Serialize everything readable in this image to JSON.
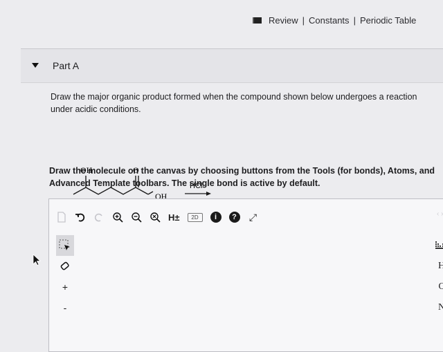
{
  "topbar": {
    "review_label": "Review",
    "sep1": "|",
    "constants_label": "Constants",
    "sep2": "|",
    "periodic_label": "Periodic Table"
  },
  "part": {
    "title": "Part A"
  },
  "question": {
    "text": "Draw the major organic product formed when the compound shown below undergoes a reaction under acidic conditions."
  },
  "molecule": {
    "oh_top": "OH",
    "o_top": "O",
    "oh_right": "OH",
    "reagent": "HCl"
  },
  "instructions": {
    "text": "Draw the molecule on the canvas by choosing buttons from the Tools (for bonds), Atoms, and Advanced Template toolbars. The single bond is active by default."
  },
  "toolbar": {
    "icons": [
      "new-document-icon",
      "undo-icon",
      "redo-icon",
      "zoom-in-icon",
      "zoom-out-icon",
      "zoom-reset-icon",
      "hydrogen-toggle-icon",
      "2d-clean-icon",
      "info-icon",
      "help-icon",
      "expand-icon"
    ],
    "h_label": "H±",
    "twod_label": "2D"
  },
  "left_tools": [
    "select-icon",
    "eraser-icon",
    "plus-charge-icon",
    "minus-charge-icon"
  ],
  "atoms": [
    "H",
    "C",
    "N"
  ]
}
